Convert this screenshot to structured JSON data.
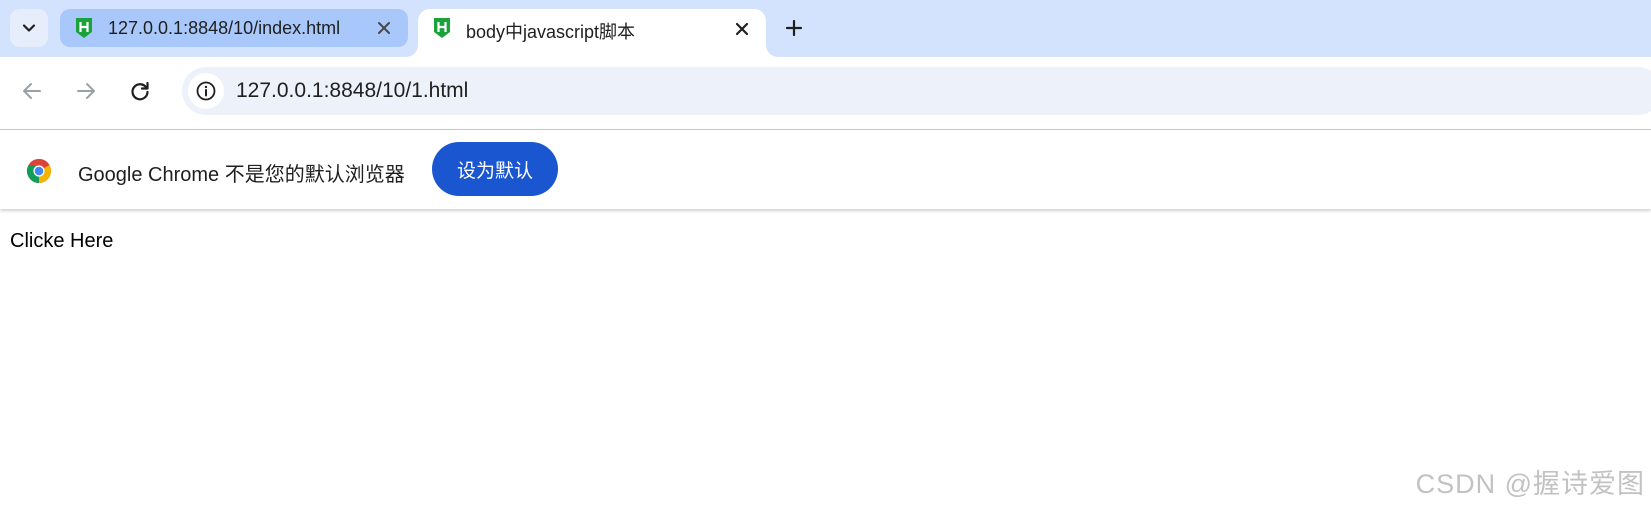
{
  "tabs": [
    {
      "title": "127.0.0.1:8848/10/index.html",
      "active": false,
      "favicon": "hbuilder-icon"
    },
    {
      "title": "body中javascript脚本",
      "active": true,
      "favicon": "hbuilder-icon"
    }
  ],
  "toolbar": {
    "url": "127.0.0.1:8848/10/1.html"
  },
  "infobar": {
    "message": "Google Chrome 不是您的默认浏览器",
    "button_label": "设为默认"
  },
  "page": {
    "link_text": "Clicke Here",
    "watermark": "CSDN @握诗爱图"
  },
  "colors": {
    "tabstrip_bg": "#d3e3fd",
    "inactive_tab_bg": "#a8c7fa",
    "omnibox_bg": "#edf2fa",
    "button_bg": "#1a56d0",
    "favicon_green": "#1aa33a"
  }
}
